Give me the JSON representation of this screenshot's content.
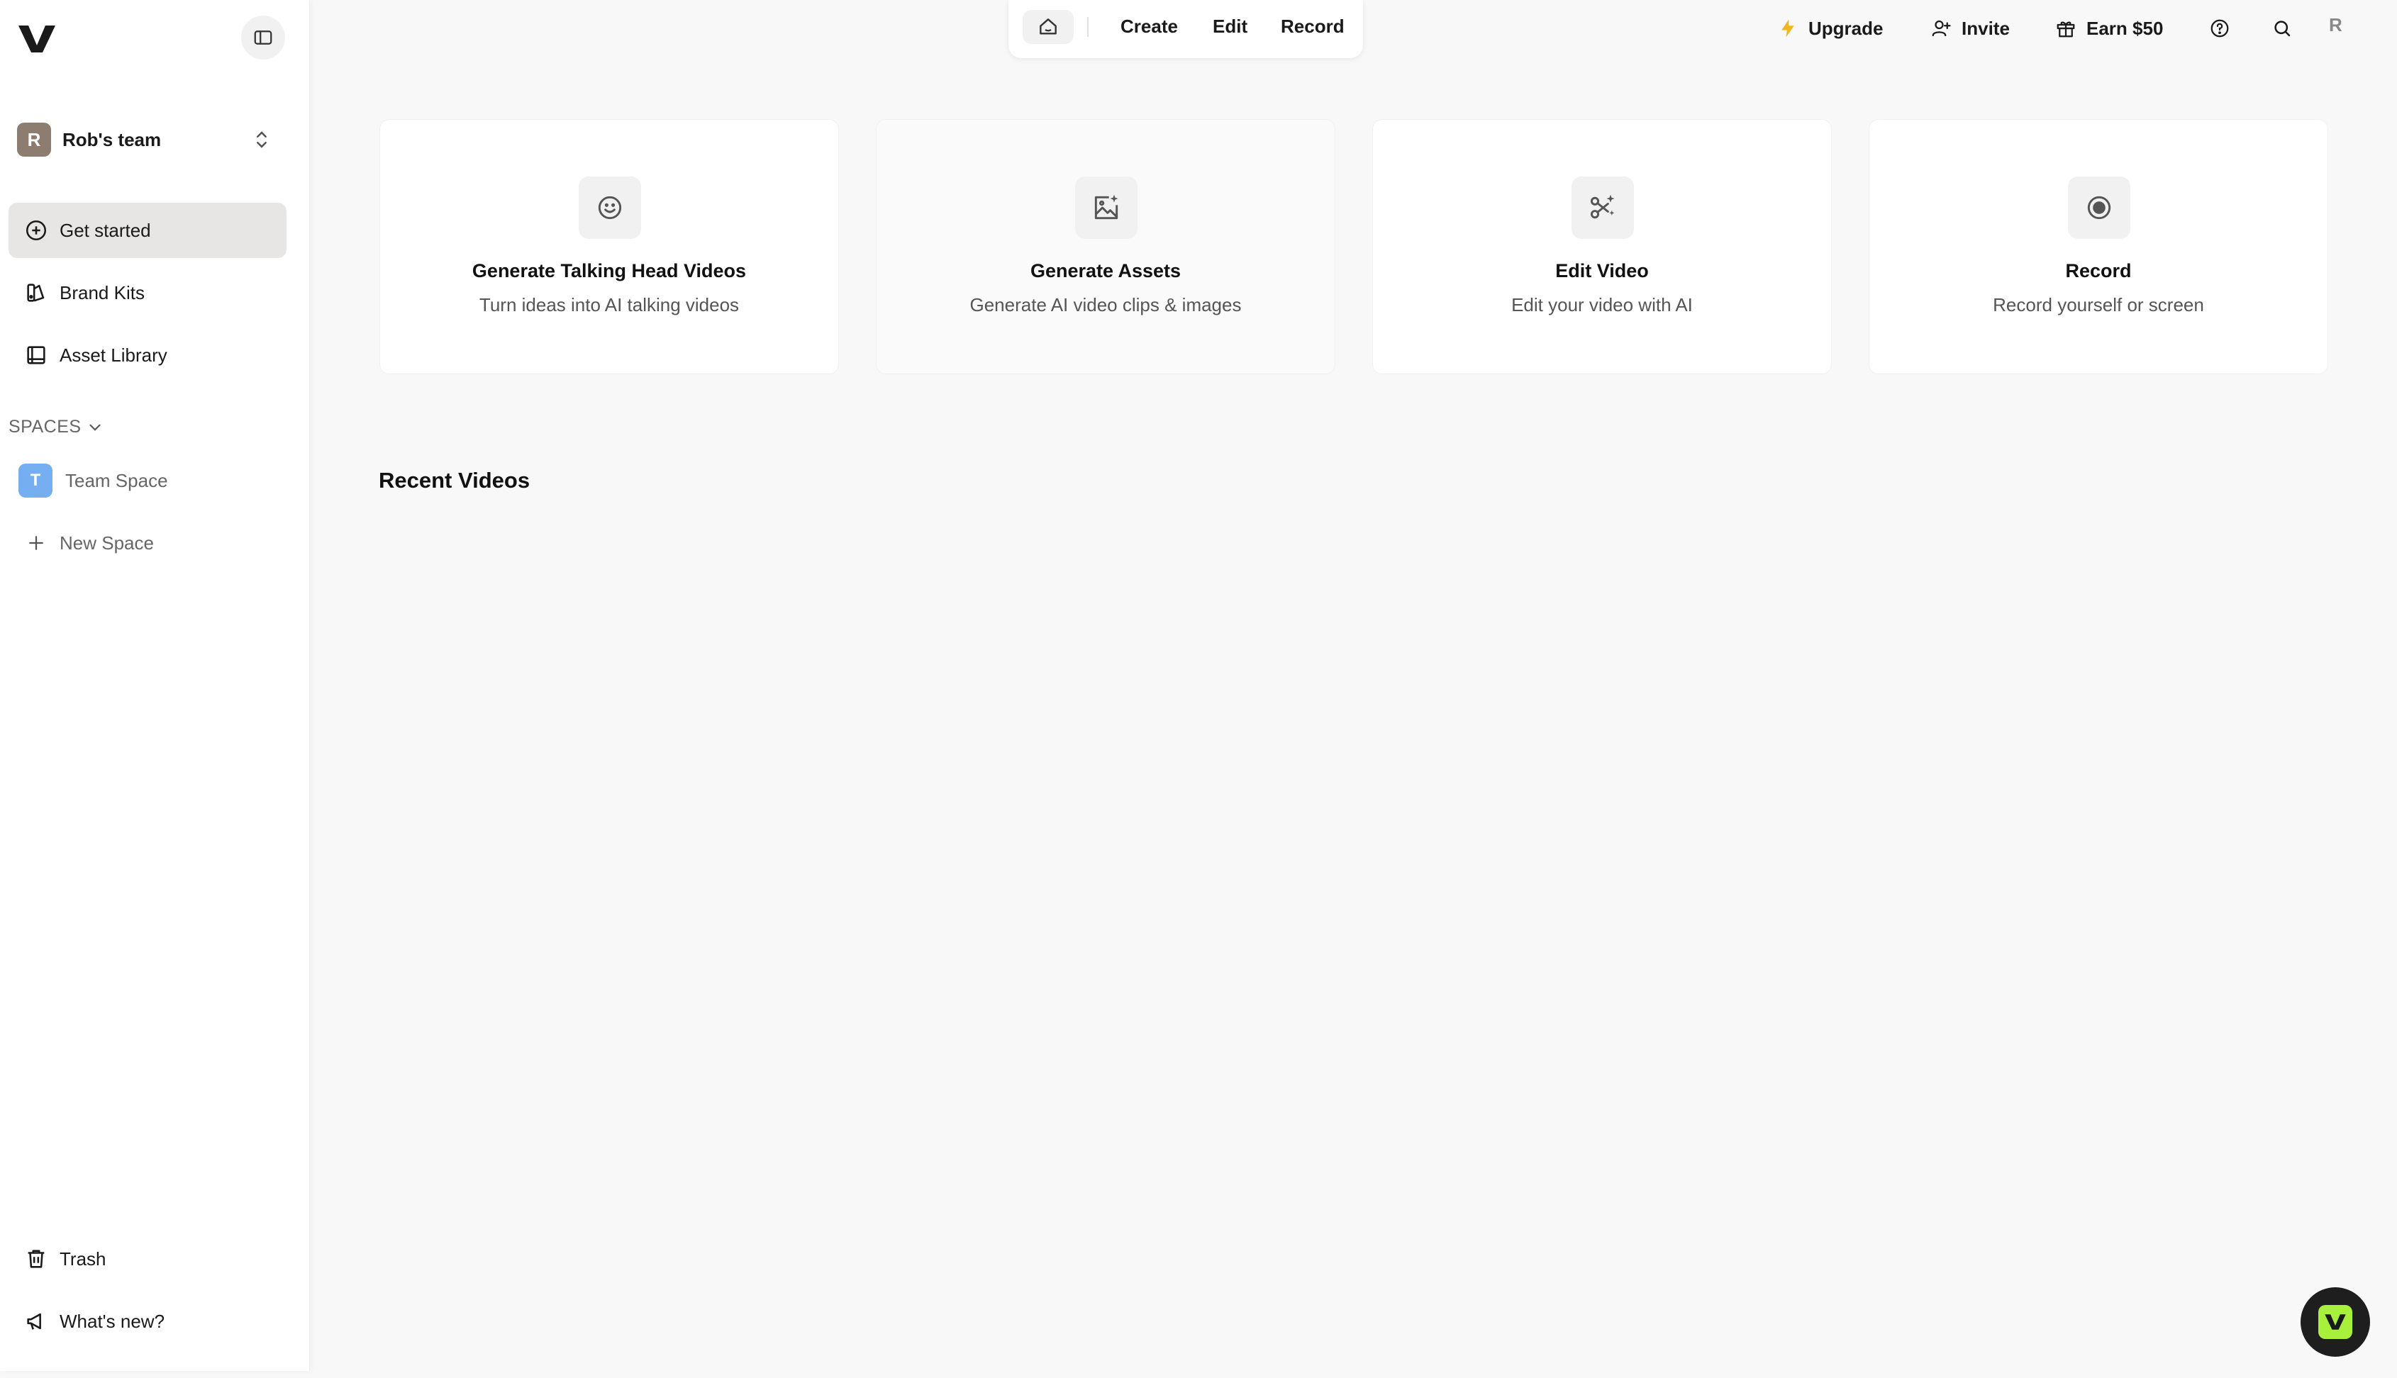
{
  "sidebar": {
    "team": {
      "initial": "R",
      "name": "Rob's team"
    },
    "nav": [
      {
        "label": "Get started",
        "icon": "plus-circle-icon",
        "active": true
      },
      {
        "label": "Brand Kits",
        "icon": "brand-kit-icon"
      },
      {
        "label": "Asset Library",
        "icon": "library-icon"
      }
    ],
    "spaces_header": "SPACES",
    "spaces": [
      {
        "initial": "T",
        "label": "Team Space"
      }
    ],
    "new_space": "New Space",
    "bottom": [
      {
        "label": "Trash",
        "icon": "trash-icon"
      },
      {
        "label": "What's new?",
        "icon": "megaphone-icon"
      }
    ]
  },
  "topnav": {
    "create": "Create",
    "edit": "Edit",
    "record": "Record"
  },
  "header_actions": {
    "upgrade": "Upgrade",
    "invite": "Invite",
    "earn": "Earn $50",
    "user_initial": "R"
  },
  "cards": [
    {
      "title": "Generate Talking Head Videos",
      "subtitle": "Turn ideas into AI talking videos",
      "icon": "smile-icon"
    },
    {
      "title": "Generate Assets",
      "subtitle": "Generate AI video clips & images",
      "icon": "image-sparkle-icon"
    },
    {
      "title": "Edit Video",
      "subtitle": "Edit your video with AI",
      "icon": "scissors-sparkle-icon"
    },
    {
      "title": "Record",
      "subtitle": "Record yourself or screen",
      "icon": "record-icon"
    }
  ],
  "recent_videos_title": "Recent Videos",
  "colors": {
    "accent_green": "#a8f03c",
    "upgrade_bolt": "#f2b51c",
    "space_badge": "#76aef2",
    "team_avatar": "#8d7d70"
  }
}
